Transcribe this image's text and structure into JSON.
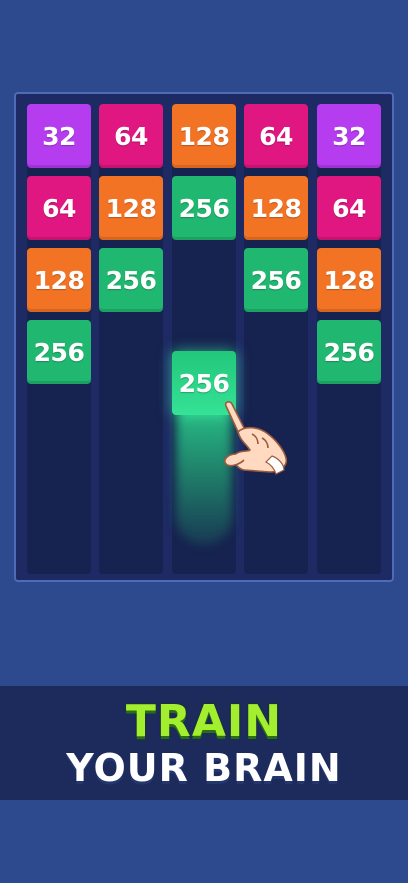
{
  "board": {
    "columns": [
      {
        "tiles": [
          "32",
          "64",
          "128",
          "256"
        ]
      },
      {
        "tiles": [
          "64",
          "128",
          "256"
        ]
      },
      {
        "tiles": [
          "128",
          "256"
        ]
      },
      {
        "tiles": [
          "64",
          "128",
          "256"
        ]
      },
      {
        "tiles": [
          "32",
          "64",
          "128",
          "256"
        ]
      }
    ],
    "dragged_tile": "256"
  },
  "banner": {
    "line1": "TRAIN",
    "line2": "YOUR BRAIN"
  },
  "colors": {
    "background": "#2e4a8f",
    "board": "#1d2a63",
    "tile_32": "#b63cf0",
    "tile_64": "#e01780",
    "tile_128": "#f37324",
    "tile_256": "#20b870",
    "banner_green": "#a3ef2f"
  },
  "icons": {
    "pointer": "tap-hand-icon"
  }
}
